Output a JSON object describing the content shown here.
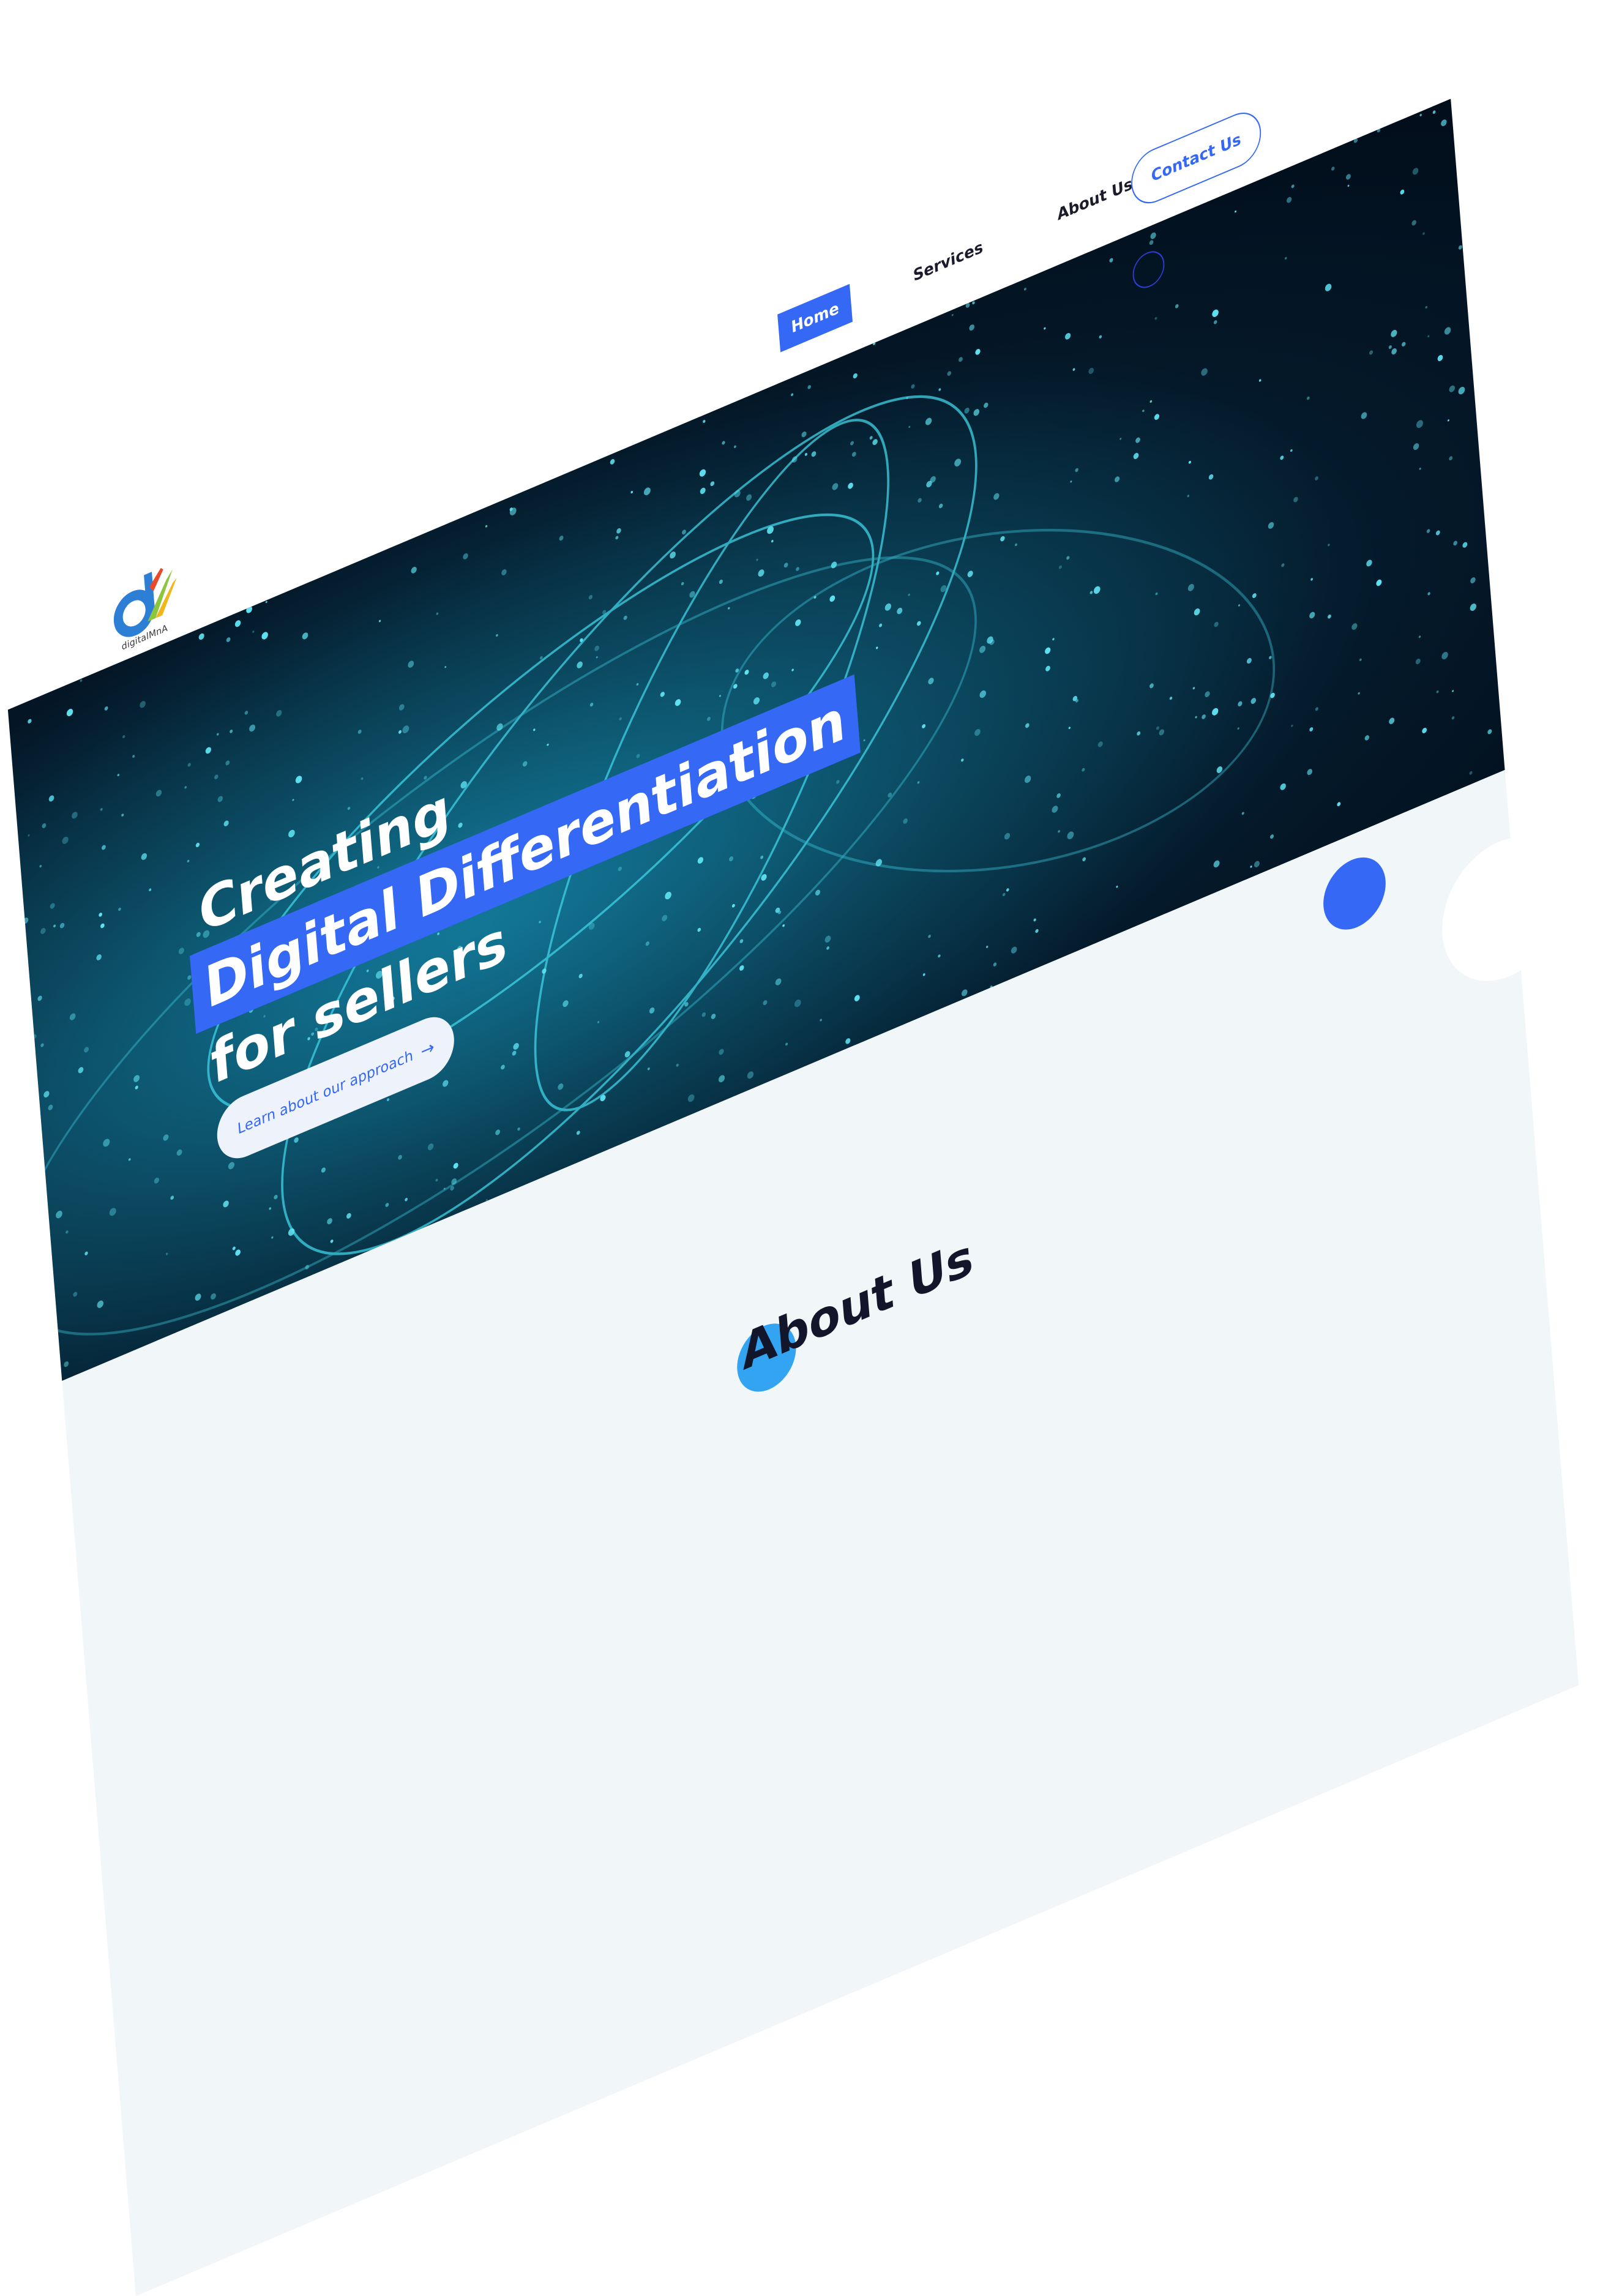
{
  "brand": {
    "name": "digitalMnA",
    "accent": "#3569f5"
  },
  "nav": {
    "items": [
      {
        "label": "Home",
        "active": true
      },
      {
        "label": "Services",
        "active": false
      },
      {
        "label": "About Us",
        "active": false
      }
    ],
    "contact_label": "Contact Us"
  },
  "hero": {
    "line1": "Creating",
    "line2": "Digital Differentiation",
    "line3": "for sellers",
    "cta_label": "Learn about our approach",
    "cta_icon": "arrow-right-icon"
  },
  "about": {
    "title": "About Us"
  }
}
